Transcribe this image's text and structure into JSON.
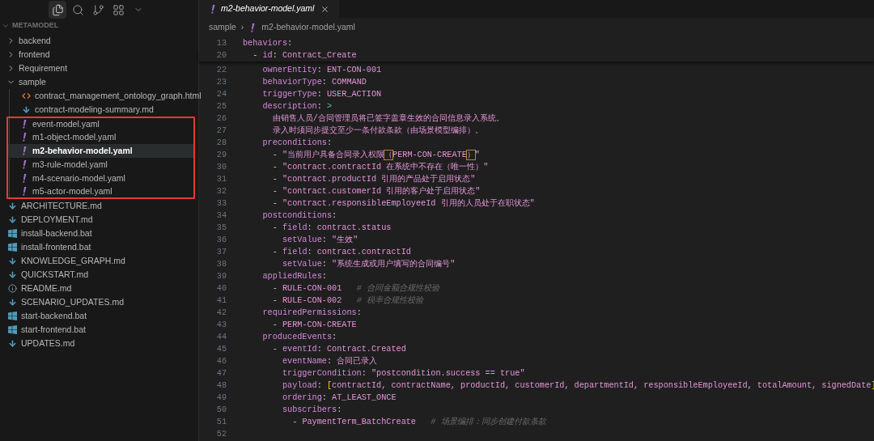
{
  "sidebar": {
    "activity_icons": [
      {
        "kind": "files",
        "selected": true
      },
      {
        "kind": "search",
        "selected": false
      },
      {
        "kind": "source-control",
        "selected": false
      },
      {
        "kind": "extensions",
        "selected": false
      },
      {
        "kind": "more",
        "selected": false
      }
    ],
    "header": "METAMODEL",
    "tree": [
      {
        "kind": "folder",
        "name": "backend",
        "expanded": false
      },
      {
        "kind": "folder",
        "name": "frontend",
        "expanded": false
      },
      {
        "kind": "folder",
        "name": "Requirement",
        "expanded": false
      },
      {
        "kind": "folder",
        "name": "sample",
        "expanded": true,
        "children": [
          {
            "kind": "html",
            "name": "contract_management_ontology_graph.html",
            "selected": false,
            "highlighted": false
          },
          {
            "kind": "markdown",
            "name": "contract-modeling-summary.md",
            "selected": false,
            "highlighted": false
          },
          {
            "kind": "yaml",
            "name": "event-model.yaml",
            "selected": false,
            "highlighted": true
          },
          {
            "kind": "yaml",
            "name": "m1-object-model.yaml",
            "selected": false,
            "highlighted": true
          },
          {
            "kind": "yaml",
            "name": "m2-behavior-model.yaml",
            "selected": true,
            "highlighted": true
          },
          {
            "kind": "yaml",
            "name": "m3-rule-model.yaml",
            "selected": false,
            "highlighted": true
          },
          {
            "kind": "yaml",
            "name": "m4-scenario-model.yaml",
            "selected": false,
            "highlighted": true
          },
          {
            "kind": "yaml",
            "name": "m5-actor-model.yaml",
            "selected": false,
            "highlighted": true
          }
        ]
      },
      {
        "kind": "markdown",
        "name": "ARCHITECTURE.md",
        "selected": false,
        "highlighted": false
      },
      {
        "kind": "markdown",
        "name": "DEPLOYMENT.md",
        "selected": false,
        "highlighted": false
      },
      {
        "kind": "batch",
        "name": "install-backend.bat",
        "selected": false,
        "highlighted": false
      },
      {
        "kind": "batch",
        "name": "install-frontend.bat",
        "selected": false,
        "highlighted": false
      },
      {
        "kind": "markdown",
        "name": "KNOWLEDGE_GRAPH.md",
        "selected": false,
        "highlighted": false
      },
      {
        "kind": "markdown",
        "name": "QUICKSTART.md",
        "selected": false,
        "highlighted": false
      },
      {
        "kind": "info",
        "name": "README.md",
        "selected": false,
        "highlighted": false
      },
      {
        "kind": "markdown",
        "name": "SCENARIO_UPDATES.md",
        "selected": false,
        "highlighted": false
      },
      {
        "kind": "batch",
        "name": "start-backend.bat",
        "selected": false,
        "highlighted": false
      },
      {
        "kind": "batch",
        "name": "start-frontend.bat",
        "selected": false,
        "highlighted": false
      },
      {
        "kind": "markdown",
        "name": "UPDATES.md",
        "selected": false,
        "highlighted": false
      }
    ]
  },
  "editor": {
    "tab": {
      "label": "m2-behavior-model.yaml",
      "selected": true
    },
    "breadcrumb": {
      "folder": "sample",
      "separator": "›",
      "file": "m2-behavior-model.yaml"
    },
    "lines": [
      {
        "number": "13",
        "segments": [
          {
            "kind": "key",
            "text": "behaviors"
          },
          {
            "kind": "punct",
            "text": ":"
          }
        ]
      },
      {
        "number": "20",
        "segments": [
          {
            "kind": "punct",
            "text": "  - "
          },
          {
            "kind": "key",
            "text": "id"
          },
          {
            "kind": "punct",
            "text": ":"
          },
          {
            "kind": "value",
            "text": " Contract_Create"
          }
        ]
      },
      {
        "number": "22",
        "segments": [
          {
            "kind": "key",
            "text": "    ownerEntity"
          },
          {
            "kind": "punct",
            "text": ":"
          },
          {
            "kind": "value",
            "text": " ENT-CON-001"
          }
        ]
      },
      {
        "number": "23",
        "segments": [
          {
            "kind": "key",
            "text": "    behaviorType"
          },
          {
            "kind": "punct",
            "text": ":"
          },
          {
            "kind": "value",
            "text": " COMMAND"
          }
        ]
      },
      {
        "number": "24",
        "segments": [
          {
            "kind": "key",
            "text": "    triggerType"
          },
          {
            "kind": "punct",
            "text": ":"
          },
          {
            "kind": "value",
            "text": " USER_ACTION"
          }
        ]
      },
      {
        "number": "25",
        "segments": [
          {
            "kind": "key",
            "text": "    description"
          },
          {
            "kind": "punct",
            "text": ": "
          },
          {
            "kind": "operator",
            "text": ">"
          }
        ]
      },
      {
        "number": "26",
        "segments": [
          {
            "kind": "value",
            "text": "      由销售人员/合同管理员将已签字盖章生效的合同信息录入系统。"
          }
        ]
      },
      {
        "number": "27",
        "segments": [
          {
            "kind": "value",
            "text": "      录入时须同步提交至少一条付款条款（由场景模型编排）。"
          }
        ]
      },
      {
        "number": "28",
        "segments": [
          {
            "kind": "key",
            "text": "    preconditions"
          },
          {
            "kind": "punct",
            "text": ":"
          }
        ]
      },
      {
        "number": "29",
        "segments": [
          {
            "kind": "punct",
            "text": "      - "
          },
          {
            "kind": "value",
            "text": "\"当前用户具备合同录入权限"
          },
          {
            "kind": "bracket",
            "text": "（"
          },
          {
            "kind": "value",
            "text": "PERM-CON-CREATE"
          },
          {
            "kind": "bracket",
            "text": "）"
          },
          {
            "kind": "value",
            "text": "\""
          }
        ]
      },
      {
        "number": "30",
        "segments": [
          {
            "kind": "punct",
            "text": "      - "
          },
          {
            "kind": "value",
            "text": "\"contract.contractId 在系统中不存在（唯一性）\""
          }
        ]
      },
      {
        "number": "31",
        "segments": [
          {
            "kind": "punct",
            "text": "      - "
          },
          {
            "kind": "value",
            "text": "\"contract.productId 引用的产品处于启用状态\""
          }
        ]
      },
      {
        "number": "32",
        "segments": [
          {
            "kind": "punct",
            "text": "      - "
          },
          {
            "kind": "value",
            "text": "\"contract.customerId 引用的客户处于启用状态\""
          }
        ]
      },
      {
        "number": "33",
        "segments": [
          {
            "kind": "punct",
            "text": "      - "
          },
          {
            "kind": "value",
            "text": "\"contract.responsibleEmployeeId 引用的人员处于在职状态\""
          }
        ]
      },
      {
        "number": "34",
        "segments": [
          {
            "kind": "key",
            "text": "    postconditions"
          },
          {
            "kind": "punct",
            "text": ":"
          }
        ]
      },
      {
        "number": "35",
        "segments": [
          {
            "kind": "punct",
            "text": "      - "
          },
          {
            "kind": "key",
            "text": "field"
          },
          {
            "kind": "punct",
            "text": ":"
          },
          {
            "kind": "value",
            "text": " contract.status"
          }
        ]
      },
      {
        "number": "36",
        "segments": [
          {
            "kind": "key",
            "text": "        setValue"
          },
          {
            "kind": "punct",
            "text": ":"
          },
          {
            "kind": "value",
            "text": " \"生效\""
          }
        ]
      },
      {
        "number": "37",
        "segments": [
          {
            "kind": "punct",
            "text": "      - "
          },
          {
            "kind": "key",
            "text": "field"
          },
          {
            "kind": "punct",
            "text": ":"
          },
          {
            "kind": "value",
            "text": " contract.contractId"
          }
        ]
      },
      {
        "number": "38",
        "segments": [
          {
            "kind": "key",
            "text": "        setValue"
          },
          {
            "kind": "punct",
            "text": ":"
          },
          {
            "kind": "value",
            "text": " \"系统生成或用户填写的合同编号\""
          }
        ]
      },
      {
        "number": "39",
        "segments": [
          {
            "kind": "key",
            "text": "    appliedRules"
          },
          {
            "kind": "punct",
            "text": ":"
          }
        ]
      },
      {
        "number": "40",
        "segments": [
          {
            "kind": "punct",
            "text": "      - "
          },
          {
            "kind": "value",
            "text": "RULE-CON-001"
          },
          {
            "kind": "comment",
            "text": "   # 合同金额合规性校验"
          }
        ]
      },
      {
        "number": "41",
        "segments": [
          {
            "kind": "punct",
            "text": "      - "
          },
          {
            "kind": "value",
            "text": "RULE-CON-002"
          },
          {
            "kind": "comment",
            "text": "   # 税率合规性校验"
          }
        ]
      },
      {
        "number": "42",
        "segments": [
          {
            "kind": "key",
            "text": "    requiredPermissions"
          },
          {
            "kind": "punct",
            "text": ":"
          }
        ]
      },
      {
        "number": "43",
        "segments": [
          {
            "kind": "punct",
            "text": "      - "
          },
          {
            "kind": "value",
            "text": "PERM-CON-CREATE"
          }
        ]
      },
      {
        "number": "44",
        "segments": [
          {
            "kind": "key",
            "text": "    producedEvents"
          },
          {
            "kind": "punct",
            "text": ":"
          }
        ]
      },
      {
        "number": "45",
        "segments": [
          {
            "kind": "punct",
            "text": "      - "
          },
          {
            "kind": "key",
            "text": "eventId"
          },
          {
            "kind": "punct",
            "text": ":"
          },
          {
            "kind": "value",
            "text": " Contract.Created"
          }
        ]
      },
      {
        "number": "46",
        "segments": [
          {
            "kind": "key",
            "text": "        eventName"
          },
          {
            "kind": "punct",
            "text": ":"
          },
          {
            "kind": "value",
            "text": " 合同已录入"
          }
        ]
      },
      {
        "number": "47",
        "segments": [
          {
            "kind": "key",
            "text": "        triggerCondition"
          },
          {
            "kind": "punct",
            "text": ":"
          },
          {
            "kind": "value",
            "text": " \"postcondition.success == true\""
          }
        ]
      },
      {
        "number": "48",
        "segments": [
          {
            "kind": "key",
            "text": "        payload"
          },
          {
            "kind": "punct",
            "text": ": "
          },
          {
            "kind": "brace",
            "text": "["
          },
          {
            "kind": "value",
            "text": "contractId, contractName, productId, customerId, departmentId, responsibleEmployeeId, totalAmount, signedDate"
          },
          {
            "kind": "brace",
            "text": "]"
          }
        ]
      },
      {
        "number": "49",
        "segments": [
          {
            "kind": "key",
            "text": "        ordering"
          },
          {
            "kind": "punct",
            "text": ":"
          },
          {
            "kind": "value",
            "text": " AT_LEAST_ONCE"
          }
        ]
      },
      {
        "number": "50",
        "segments": [
          {
            "kind": "key",
            "text": "        subscribers"
          },
          {
            "kind": "punct",
            "text": ":"
          }
        ]
      },
      {
        "number": "51",
        "segments": [
          {
            "kind": "punct",
            "text": "          - "
          },
          {
            "kind": "value",
            "text": "PaymentTerm_BatchCreate"
          },
          {
            "kind": "comment",
            "text": "   # 场景编排：同步创建付款条款"
          }
        ]
      },
      {
        "number": "52"
      }
    ]
  }
}
